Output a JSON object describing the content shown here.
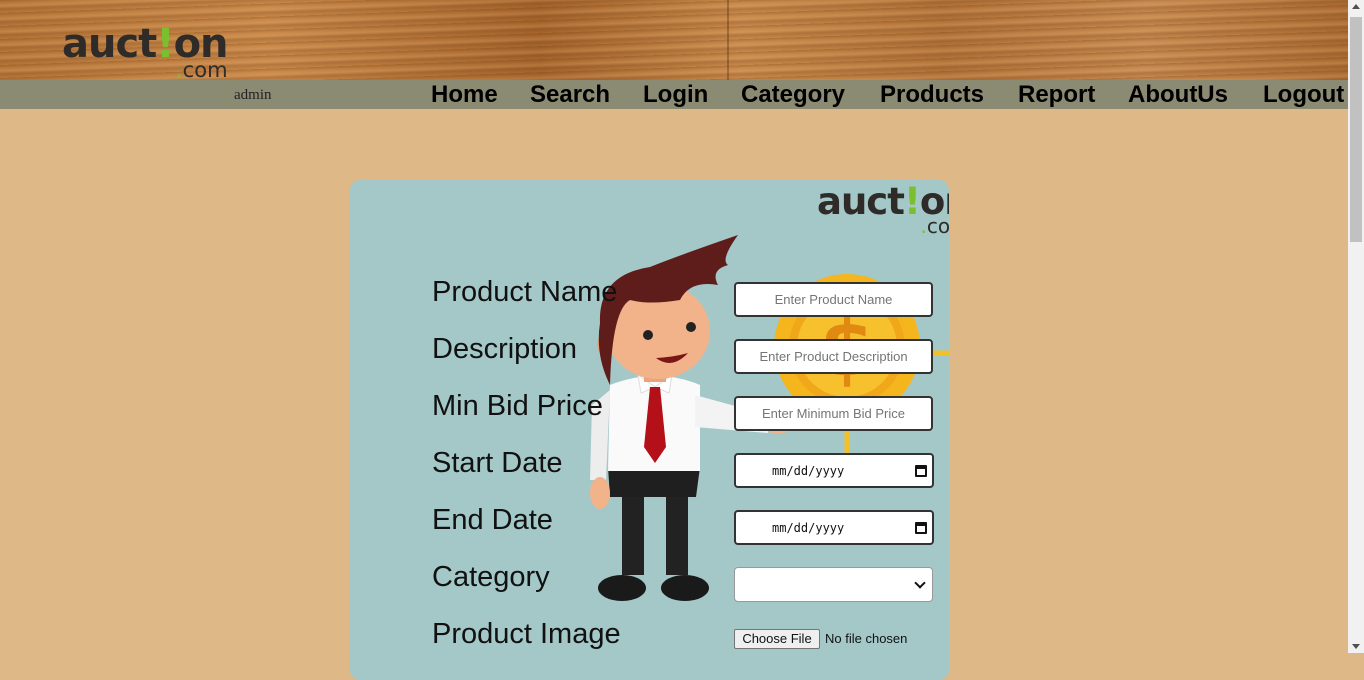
{
  "header": {
    "logo": {
      "main_before": "auct",
      "main_bang": "!",
      "main_after": "on",
      "dot": ".",
      "suffix": "com"
    }
  },
  "navbar": {
    "user": "admin",
    "items": [
      {
        "label": "Home"
      },
      {
        "label": "Search"
      },
      {
        "label": "Login"
      },
      {
        "label": "Category"
      },
      {
        "label": "Products"
      },
      {
        "label": "Report"
      },
      {
        "label": "AboutUs"
      },
      {
        "label": "Logout"
      }
    ]
  },
  "card": {
    "logo": {
      "main_before": "auct",
      "main_bang": "!",
      "main_after": "on",
      "dot": ".",
      "suffix": "com"
    }
  },
  "form": {
    "labels": {
      "product_name": "Product Name",
      "description": "Description",
      "min_bid": "Min Bid Price",
      "start_date": "Start Date",
      "end_date": "End Date",
      "category": "Category",
      "image": "Product Image"
    },
    "placeholders": {
      "product_name": "Enter Product Name",
      "description": "Enter Product Description",
      "min_bid": "Enter Minimum Bid Price"
    },
    "start_date_value": "mm/dd/yyyy",
    "end_date_value": "mm/dd/yyyy",
    "category_value": "",
    "file_button": "Choose File",
    "file_status": "No file chosen"
  },
  "colors": {
    "page_bg": "#deb887",
    "navbar_bg": "#8b8a72",
    "card_bg": "#a4c8c8",
    "logo_accent": "#7cbf2e"
  }
}
